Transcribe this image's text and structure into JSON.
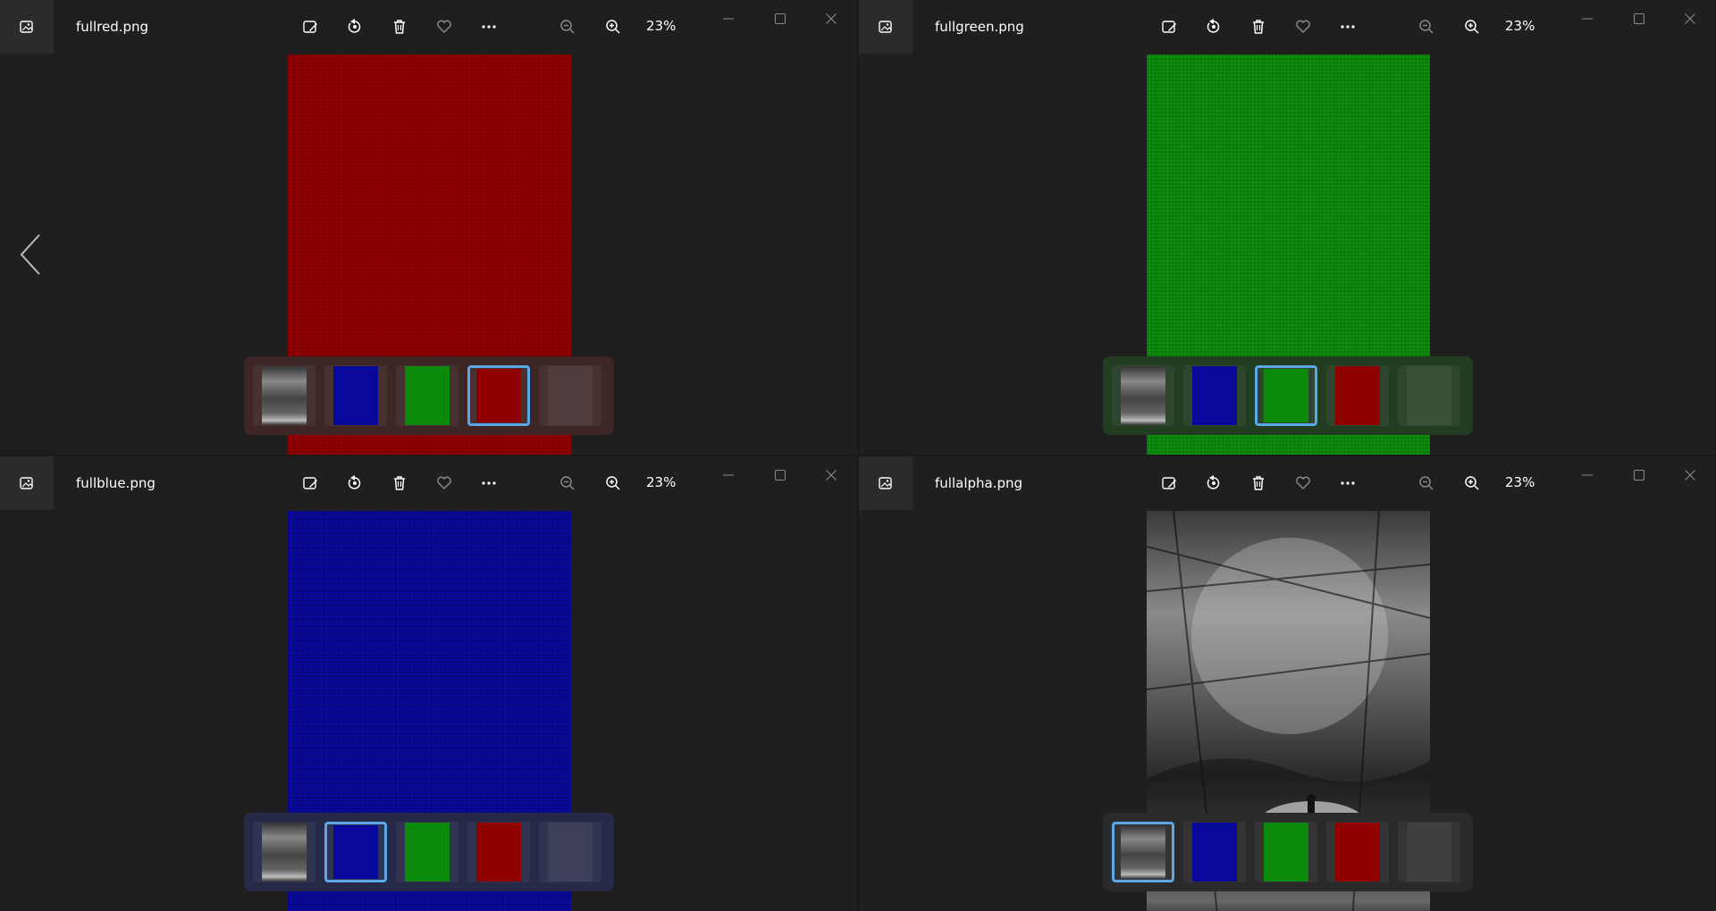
{
  "colors": {
    "accent": "#5aa8e8",
    "red": "#8f0000",
    "green": "#0c8a0c",
    "blue": "#08089a"
  },
  "windows": [
    {
      "title": "fullred.png",
      "zoom": "23%",
      "selected_thumb": 4
    },
    {
      "title": "fullgreen.png",
      "zoom": "23%",
      "selected_thumb": 3
    },
    {
      "title": "fullblue.png",
      "zoom": "23%",
      "selected_thumb": 2
    },
    {
      "title": "fullalpha.png",
      "zoom": "23%",
      "selected_thumb": 1
    }
  ],
  "icons": {
    "app": "photos-app-icon",
    "edit": "edit-image-icon",
    "rotate": "rotate-icon",
    "delete": "trash-icon",
    "favorite": "heart-icon",
    "more": "more-icon",
    "zoom_out": "zoom-out-icon",
    "zoom_in": "zoom-in-icon",
    "minimize": "minimize-icon",
    "maximize": "maximize-icon",
    "close": "close-icon",
    "prev": "chevron-left-icon"
  }
}
